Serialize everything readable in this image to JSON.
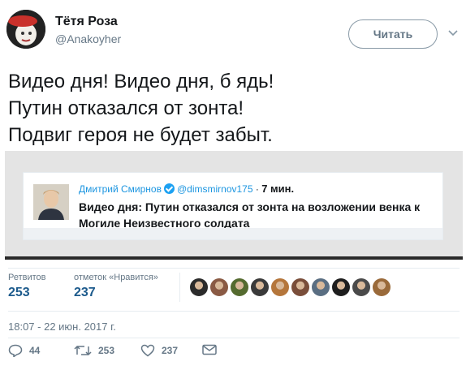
{
  "author": {
    "name": "Тётя Роза",
    "handle": "@Anakoyher"
  },
  "follow_label": "Читать",
  "tweet_text": "Видео дня! Видео дня, б  ядь!\nПутин отказался от зонта!\nПодвиг героя не будет забыт.",
  "quoted": {
    "name": "Дмитрий Смирнов",
    "handle": "@dimsmirnov175",
    "separator": "·",
    "time": "7 мин.",
    "text": "Видео дня: Путин отказался от зонта на возложении венка к Могиле Неизвестного солдата"
  },
  "stats": {
    "retweets_label": "Ретвитов",
    "retweets": "253",
    "likes_label": "отметок «Нравится»",
    "likes": "237"
  },
  "likers": [
    "#2b2b2b",
    "#8a5a44",
    "#556b2f",
    "#3a3a3a",
    "#b5763b",
    "#7a4e3a",
    "#5a6e82",
    "#1e1e1e",
    "#4a4a4a",
    "#9a6a3a"
  ],
  "timestamp": "18:07 - 22 июн. 2017 г.",
  "actions": {
    "reply_count": "44",
    "retweet_count": "253",
    "like_count": "237"
  },
  "colors": {
    "text_secondary": "#657786",
    "link": "#1b95e0",
    "stat_value": "#1c5a8c"
  }
}
